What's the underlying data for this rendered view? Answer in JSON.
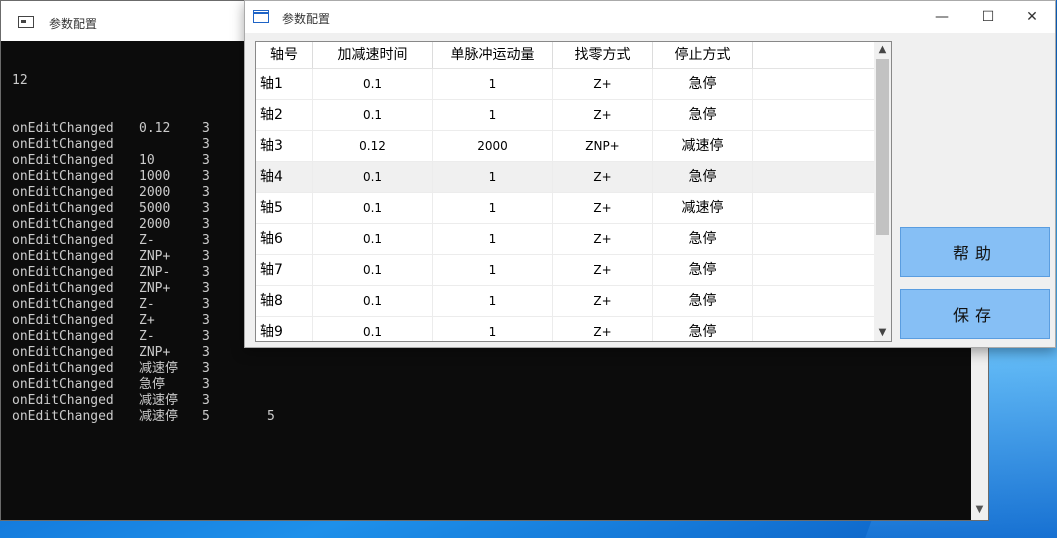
{
  "console": {
    "title": "参数配置",
    "first_line": "12",
    "lines": [
      {
        "event": "onEditChanged",
        "value": "0.12",
        "col": "3",
        "extra": ""
      },
      {
        "event": "onEditChanged",
        "value": "",
        "col": "3",
        "extra": ""
      },
      {
        "event": "onEditChanged",
        "value": "10",
        "col": "3",
        "extra": ""
      },
      {
        "event": "onEditChanged",
        "value": "1000",
        "col": "3",
        "extra": ""
      },
      {
        "event": "onEditChanged",
        "value": "2000",
        "col": "3",
        "extra": ""
      },
      {
        "event": "onEditChanged",
        "value": "5000",
        "col": "3",
        "extra": ""
      },
      {
        "event": "onEditChanged",
        "value": "2000",
        "col": "3",
        "extra": ""
      },
      {
        "event": "onEditChanged",
        "value": "Z-",
        "col": "3",
        "extra": ""
      },
      {
        "event": "onEditChanged",
        "value": "ZNP+",
        "col": "3",
        "extra": ""
      },
      {
        "event": "onEditChanged",
        "value": "ZNP-",
        "col": "3",
        "extra": ""
      },
      {
        "event": "onEditChanged",
        "value": "ZNP+",
        "col": "3",
        "extra": ""
      },
      {
        "event": "onEditChanged",
        "value": "Z-",
        "col": "3",
        "extra": ""
      },
      {
        "event": "onEditChanged",
        "value": "Z+",
        "col": "3",
        "extra": ""
      },
      {
        "event": "onEditChanged",
        "value": "Z-",
        "col": "3",
        "extra": ""
      },
      {
        "event": "onEditChanged",
        "value": "ZNP+",
        "col": "3",
        "extra": ""
      },
      {
        "event": "onEditChanged",
        "value": "减速停",
        "col": "3",
        "extra": ""
      },
      {
        "event": "onEditChanged",
        "value": "急停",
        "col": "3",
        "extra": ""
      },
      {
        "event": "onEditChanged",
        "value": "减速停",
        "col": "3",
        "extra": ""
      },
      {
        "event": "onEditChanged",
        "value": "减速停",
        "col": "5",
        "extra": "5"
      }
    ]
  },
  "param_window": {
    "title": "参数配置",
    "minimize_glyph": "—",
    "maximize_glyph": "☐",
    "close_glyph": "✕",
    "columns": [
      "轴号",
      "加减速时间",
      "单脉冲运动量",
      "找零方式",
      "停止方式"
    ],
    "rows": [
      {
        "axis": "轴1",
        "accel": "0.1",
        "pulse": "1",
        "home": "Z+",
        "stop": "急停"
      },
      {
        "axis": "轴2",
        "accel": "0.1",
        "pulse": "1",
        "home": "Z+",
        "stop": "急停"
      },
      {
        "axis": "轴3",
        "accel": "0.12",
        "pulse": "2000",
        "home": "ZNP+",
        "stop": "减速停"
      },
      {
        "axis": "轴4",
        "accel": "0.1",
        "pulse": "1",
        "home": "Z+",
        "stop": "急停"
      },
      {
        "axis": "轴5",
        "accel": "0.1",
        "pulse": "1",
        "home": "Z+",
        "stop": "减速停"
      },
      {
        "axis": "轴6",
        "accel": "0.1",
        "pulse": "1",
        "home": "Z+",
        "stop": "急停"
      },
      {
        "axis": "轴7",
        "accel": "0.1",
        "pulse": "1",
        "home": "Z+",
        "stop": "急停"
      },
      {
        "axis": "轴8",
        "accel": "0.1",
        "pulse": "1",
        "home": "Z+",
        "stop": "急停"
      },
      {
        "axis": "轴9",
        "accel": "0.1",
        "pulse": "1",
        "home": "Z+",
        "stop": "急停"
      }
    ],
    "highlighted_row": 3,
    "help_label": "帮助",
    "save_label": "保存",
    "scroll_up_glyph": "▲",
    "scroll_down_glyph": "▼"
  }
}
